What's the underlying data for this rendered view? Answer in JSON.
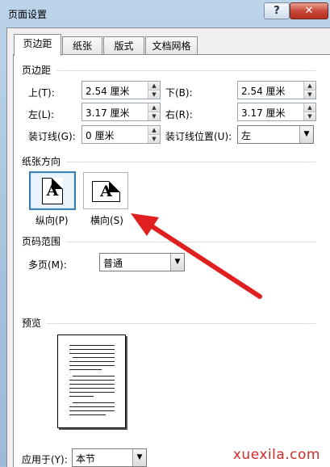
{
  "window": {
    "title": "页面设置",
    "help_label": "?",
    "close_label": "✕"
  },
  "tabs": [
    {
      "label": "页边距",
      "active": true
    },
    {
      "label": "纸张",
      "active": false
    },
    {
      "label": "版式",
      "active": false
    },
    {
      "label": "文档网格",
      "active": false
    }
  ],
  "margins": {
    "section_title": "页边距",
    "top_label": "上(T):",
    "top_value": "2.54 厘米",
    "bottom_label": "下(B):",
    "bottom_value": "2.54 厘米",
    "left_label": "左(L):",
    "left_value": "3.17 厘米",
    "right_label": "右(R):",
    "right_value": "3.17 厘米",
    "gutter_label": "装订线(G):",
    "gutter_value": "0 厘米",
    "gutter_pos_label": "装订线位置(U):",
    "gutter_pos_value": "左"
  },
  "orientation": {
    "section_title": "纸张方向",
    "portrait_label": "纵向(P)",
    "landscape_label": "横向(S)",
    "icon_letter": "A",
    "selected": "portrait"
  },
  "pages": {
    "section_title": "页码范围",
    "multiple_label": "多页(M):",
    "multiple_value": "普通"
  },
  "preview": {
    "section_title": "预览",
    "apply_label": "应用于(Y):",
    "apply_value": "本节"
  },
  "annotation": {
    "arrow_color": "#e02020"
  },
  "watermark": "xuexila.com"
}
